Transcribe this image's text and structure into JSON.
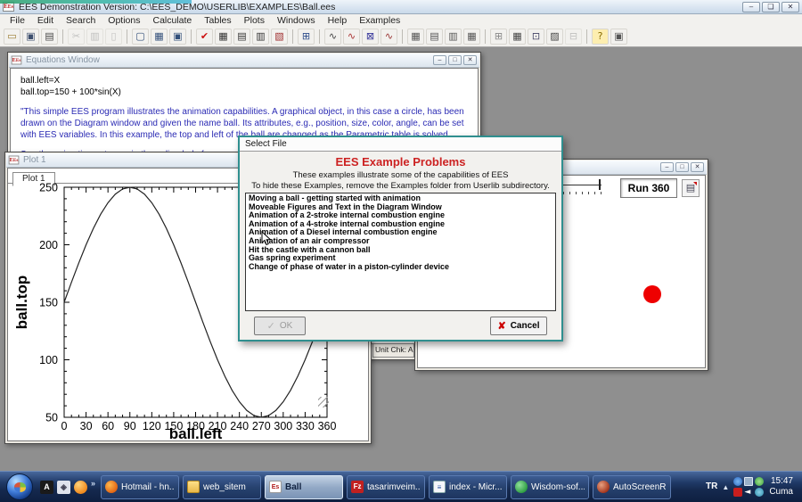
{
  "window": {
    "title": "EES Demonstration Version:    C:\\EES_DEMO\\USERLIB\\EXAMPLES\\Ball.ees",
    "min": "–",
    "max": "❏",
    "close": "✕"
  },
  "menu": {
    "items": [
      "File",
      "Edit",
      "Search",
      "Options",
      "Calculate",
      "Tables",
      "Plots",
      "Windows",
      "Help",
      "Examples"
    ]
  },
  "toolbar": {
    "buttons": [
      {
        "name": "open-file",
        "glyph": "▭",
        "color": "#9a7b2f"
      },
      {
        "name": "save",
        "glyph": "▣",
        "color": "#3d4f6e"
      },
      {
        "name": "print",
        "glyph": "▤",
        "color": "#4a4a4a"
      },
      {
        "sep": true
      },
      {
        "name": "cut",
        "glyph": "✂",
        "color": "#999",
        "enabled": false
      },
      {
        "name": "copy",
        "glyph": "▥",
        "color": "#999",
        "enabled": false
      },
      {
        "name": "paste",
        "glyph": "▯",
        "color": "#999",
        "enabled": false
      },
      {
        "sep": true
      },
      {
        "name": "equations-window",
        "glyph": "▢",
        "color": "#33507a"
      },
      {
        "name": "formatted-equations",
        "glyph": "▦",
        "color": "#33507a"
      },
      {
        "name": "solution-window",
        "glyph": "▣",
        "color": "#33507a"
      },
      {
        "sep": true
      },
      {
        "name": "solve",
        "glyph": "✔",
        "color": "#cc1111"
      },
      {
        "name": "solve-table",
        "glyph": "▦",
        "color": "#333333"
      },
      {
        "name": "min-max",
        "glyph": "▤",
        "color": "#333333"
      },
      {
        "name": "update-guesses",
        "glyph": "▥",
        "color": "#333333"
      },
      {
        "name": "check-units",
        "glyph": "▧",
        "color": "#a03030"
      },
      {
        "sep": true
      },
      {
        "name": "parametric-table",
        "glyph": "⊞",
        "color": "#2a4a8a"
      },
      {
        "sep": true
      },
      {
        "name": "new-plot",
        "glyph": "∿",
        "color": "#444444"
      },
      {
        "name": "overlay-plot",
        "glyph": "∿",
        "color": "#aa3333"
      },
      {
        "name": "modify-plot",
        "glyph": "⊠",
        "color": "#333399"
      },
      {
        "name": "property-plot",
        "glyph": "∿",
        "color": "#993333"
      },
      {
        "sep": true
      },
      {
        "name": "new-parametric-table",
        "glyph": "▦",
        "color": "#555555"
      },
      {
        "name": "new-lookup-table",
        "glyph": "▤",
        "color": "#555555"
      },
      {
        "name": "arrays-table",
        "glyph": "▥",
        "color": "#555555"
      },
      {
        "name": "integrals-table",
        "glyph": "▦",
        "color": "#555555"
      },
      {
        "sep": true
      },
      {
        "name": "merge-tables",
        "glyph": "⊞",
        "color": "#888888"
      },
      {
        "name": "table-properties",
        "glyph": "▦",
        "color": "#444444"
      },
      {
        "name": "report-window",
        "glyph": "⊡",
        "color": "#444466"
      },
      {
        "name": "diagram-window",
        "glyph": "▨",
        "color": "#444444"
      },
      {
        "name": "clear",
        "glyph": "⊟",
        "color": "#999999",
        "enabled": false
      },
      {
        "sep": true
      },
      {
        "name": "help",
        "glyph": "?",
        "color": "#8a6d00"
      },
      {
        "name": "examples",
        "glyph": "▣",
        "color": "#555555"
      }
    ]
  },
  "equations_window": {
    "title": "Equations Window",
    "lines": [
      {
        "t": "ball.left=X",
        "c": "code"
      },
      {
        "t": "ball.top=150 + 100*sin(X)",
        "c": "code"
      },
      {
        "t": "",
        "c": "blank"
      },
      {
        "t": "\"This simple EES program illustrates the animation capabilities.  A graphical object, in this case a circle, has been",
        "c": "comment"
      },
      {
        "t": "drawn on the Diagram window and given the name ball.  Its attributes, e.g., position, size, color, angle, can be set",
        "c": "comment"
      },
      {
        "t": "with EES variables.  In this example, the top and left of the ball are changed as the Parametric table is solved.",
        "c": "comment"
      },
      {
        "t": "",
        "c": "blank"
      },
      {
        "t": "See the animation category in the online help for a more deta",
        "c": "comment"
      }
    ],
    "status_fragment": "Unit Chk: Au"
  },
  "plot_window": {
    "title": "Plot 1",
    "tab": "Plot 1"
  },
  "chart_data": {
    "type": "line",
    "title": "",
    "xlabel": "ball.left",
    "ylabel": "ball.top",
    "xlim": [
      0,
      360
    ],
    "ylim": [
      50,
      250
    ],
    "xticks": [
      0,
      30,
      60,
      90,
      120,
      150,
      180,
      210,
      240,
      270,
      300,
      330,
      360
    ],
    "yticks": [
      50,
      100,
      150,
      200,
      250
    ],
    "x_minor_step": 10,
    "y_minor_step": 10,
    "grid": false,
    "legend": false,
    "x": [
      0,
      10,
      20,
      30,
      40,
      50,
      60,
      70,
      80,
      90,
      100,
      110,
      120,
      130,
      140,
      150,
      160,
      170,
      180,
      190,
      200,
      210,
      220,
      230,
      240,
      250,
      260,
      270,
      280,
      290,
      300,
      310,
      320,
      330,
      340,
      350,
      360
    ],
    "y": [
      150,
      167.4,
      184.2,
      200,
      214.3,
      226.6,
      236.6,
      244,
      248.5,
      250,
      248.5,
      244,
      236.6,
      226.6,
      214.3,
      200,
      184.2,
      167.4,
      150,
      132.6,
      115.8,
      100,
      85.7,
      73.4,
      63.4,
      56,
      51.5,
      50,
      51.5,
      56,
      63.4,
      73.4,
      85.7,
      100,
      115.8,
      132.6,
      150
    ]
  },
  "dialog": {
    "title": "Select File",
    "heading": "EES Example Problems",
    "subtitle1": "These examples illustrate some of the capabilities of EES",
    "subtitle2": "To hide these Examples, remove the Examples folder from Userlib subdirectory.",
    "items": [
      "Moving a ball - getting started with animation",
      "Moveable Figures and Text in the Diagram Window",
      "Animation of a 2-stroke internal combustion engine",
      "Animation of a 4-stroke internal combustion engine",
      "Animation of a Diesel internal combustion engine",
      "Animation of an air compressor",
      "Hit the castle with a cannon ball",
      "Gas spring experiment",
      "Change of phase of water in a piston-cylinder device"
    ],
    "ok_label": "OK",
    "cancel_label": "Cancel",
    "border_color": "#2f8f8f",
    "heading_color": "#cc2222"
  },
  "diagram_window": {
    "run_button": "Run 360",
    "ball_color": "#ee0000"
  },
  "taskbar": {
    "quick_launch_chevron": "»",
    "buttons": [
      {
        "label": "Hotmail - hn...",
        "icon": "firefox"
      },
      {
        "label": "web_sitem",
        "icon": "folder"
      },
      {
        "label": "Ball",
        "icon": "ees",
        "active": true
      },
      {
        "label": "tasarimveim...",
        "icon": "filezilla"
      },
      {
        "label": "index - Micr...",
        "icon": "word"
      },
      {
        "label": "Wisdom-sof...",
        "icon": "wisdom"
      },
      {
        "label": "AutoScreenR...",
        "icon": "autoscreen"
      }
    ],
    "tray": {
      "lang": "TR",
      "time": "15:47",
      "day": "Cuma"
    }
  },
  "colors": {
    "mdi_background": "#8f8f8f",
    "comment_blue": "#2b2bb4",
    "solve_check_red": "#cc1111",
    "ball_red": "#ee0000",
    "dialog_border_teal": "#2f8f8f",
    "taskbar_blue": "#1b2f58"
  }
}
